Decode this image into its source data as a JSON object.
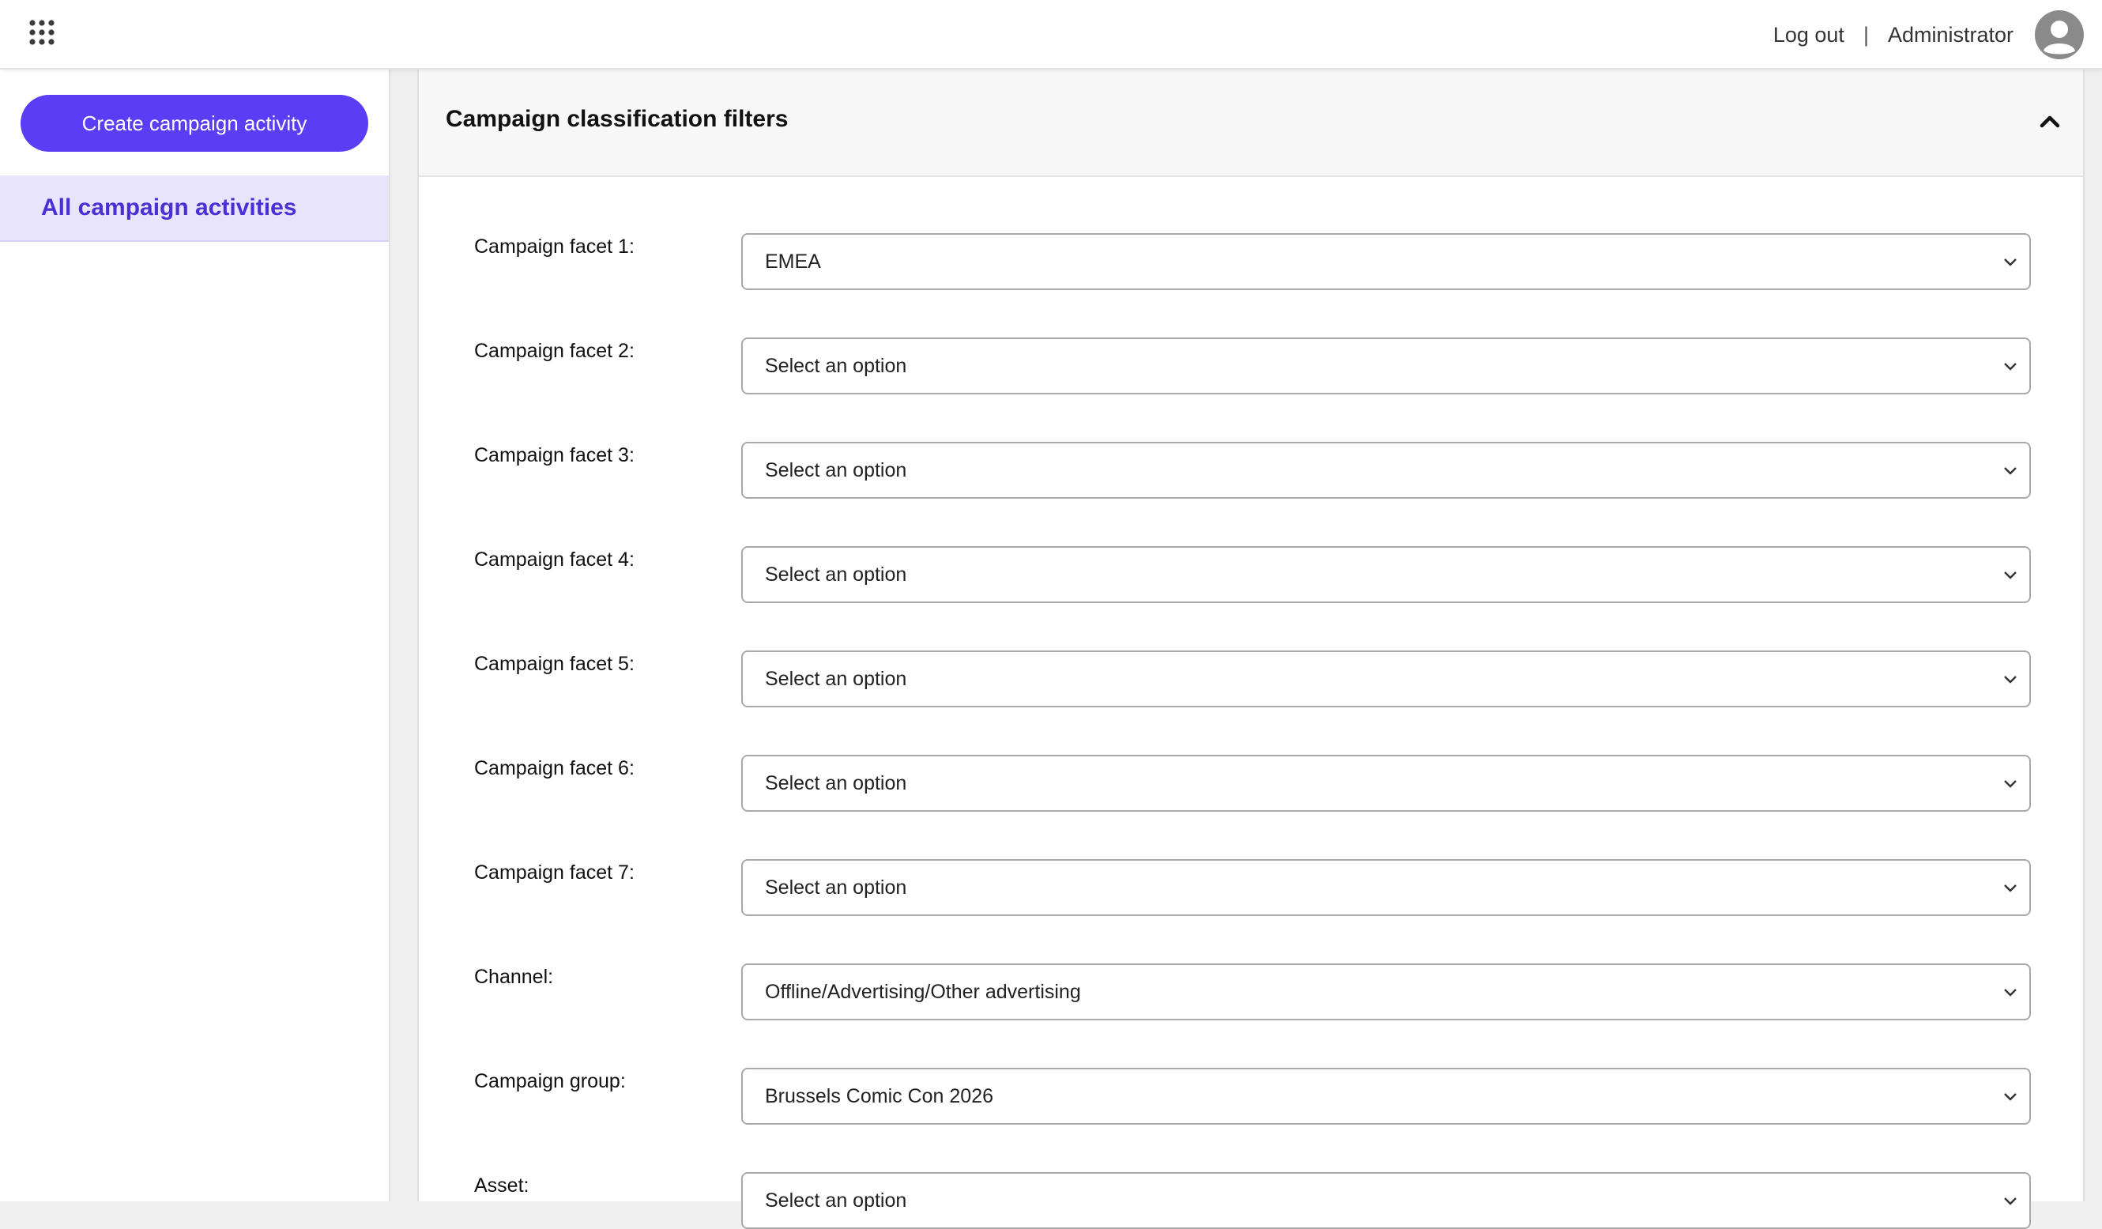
{
  "header": {
    "logout_label": "Log out",
    "separator": "|",
    "user_name": "Administrator",
    "icons": [
      "apps-grid-icon",
      "user-avatar-icon"
    ]
  },
  "sidebar": {
    "create_button_label": "Create campaign activity",
    "nav_items": [
      {
        "label": "All campaign activities",
        "active": true
      }
    ]
  },
  "panel": {
    "title": "Campaign classification filters",
    "collapse_icon": "chevron-up-icon",
    "fields": [
      {
        "label": "Campaign facet 1:",
        "value": "EMEA"
      },
      {
        "label": "Campaign facet 2:",
        "value": "Select an option"
      },
      {
        "label": "Campaign facet 3:",
        "value": "Select an option"
      },
      {
        "label": "Campaign facet 4:",
        "value": "Select an option"
      },
      {
        "label": "Campaign facet 5:",
        "value": "Select an option"
      },
      {
        "label": "Campaign facet 6:",
        "value": "Select an option"
      },
      {
        "label": "Campaign facet 7:",
        "value": "Select an option"
      },
      {
        "label": "Channel:",
        "value": "Offline/Advertising/Other advertising"
      },
      {
        "label": "Campaign group:",
        "value": "Brussels Comic Con 2026"
      },
      {
        "label": "Asset:",
        "value": "Select an option"
      }
    ]
  },
  "colors": {
    "accent": "#5b3df5",
    "nav_active_bg": "#e8e4fc",
    "nav_active_text": "#4b2fd6"
  }
}
